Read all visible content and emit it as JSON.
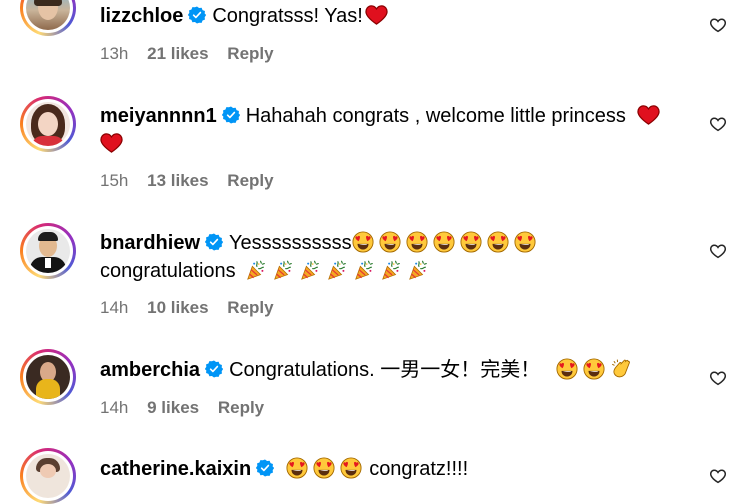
{
  "comments": [
    {
      "username": "lizzchloe",
      "text": "Congratsss! Yas!",
      "emoji_after": [
        "red-heart-icon"
      ],
      "time": "13h",
      "likes": "21 likes",
      "reply": "Reply"
    },
    {
      "username": "meiyannnn1",
      "text": "Hahahah congrats , welcome little princess",
      "emoji_after": [
        "red-heart-icon",
        "red-heart-icon"
      ],
      "time": "15h",
      "likes": "13 likes",
      "reply": "Reply"
    },
    {
      "username": "bnardhiew",
      "text": "Yessssssssss",
      "emoji_after": [
        "heart-eyes-icon",
        "heart-eyes-icon",
        "heart-eyes-icon",
        "heart-eyes-icon",
        "heart-eyes-icon",
        "heart-eyes-icon",
        "heart-eyes-icon"
      ],
      "text2": "congratulations",
      "emoji_after2": [
        "party-popper-icon",
        "party-popper-icon",
        "party-popper-icon",
        "party-popper-icon",
        "party-popper-icon",
        "party-popper-icon",
        "party-popper-icon"
      ],
      "time": "14h",
      "likes": "10 likes",
      "reply": "Reply"
    },
    {
      "username": "amberchia",
      "text": "Congratulations. 一男一女！完美！",
      "emoji_after": [
        "heart-eyes-icon",
        "heart-eyes-icon",
        "clapping-hands-icon"
      ],
      "time": "14h",
      "likes": "9 likes",
      "reply": "Reply"
    },
    {
      "username": "catherine.kaixin",
      "emoji_before": [
        "heart-eyes-icon",
        "heart-eyes-icon",
        "heart-eyes-icon"
      ],
      "text": "congratz!!!!"
    }
  ],
  "colors": {
    "verified": "#0095f6",
    "meta": "#737373",
    "heart": "#ed1c24"
  }
}
